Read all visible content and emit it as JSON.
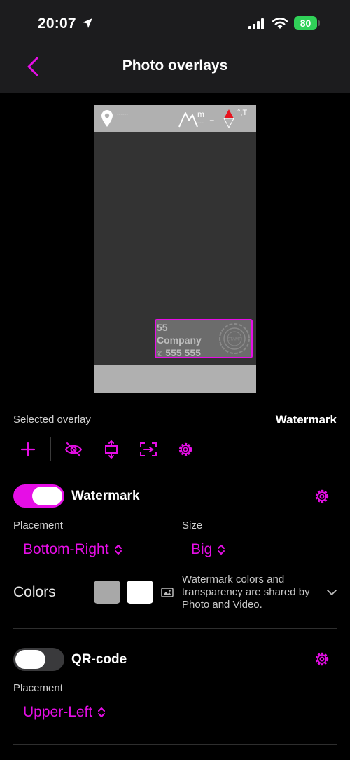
{
  "status_bar": {
    "time": "20:07",
    "battery": "80",
    "icons": [
      "location-arrow-icon",
      "cellular-signal-icon",
      "wifi-icon",
      "battery-icon"
    ]
  },
  "nav": {
    "back_icon": "chevron-left-icon",
    "title": "Photo overlays"
  },
  "preview": {
    "top_bar": {
      "location_value": "------",
      "altitude_unit": "m",
      "altitude_value": "---",
      "separator": "_",
      "temperature": "°,T"
    },
    "watermark": {
      "line1": "55",
      "line2": "Company",
      "line3": "555 555",
      "seal_text": "STAMP"
    }
  },
  "selected_overlay": {
    "label": "Selected overlay",
    "value": "Watermark"
  },
  "toolbar": {
    "icons": [
      "plus-icon",
      "eye-slash-icon",
      "resize-vertical-icon",
      "fit-frame-icon",
      "gear-icon"
    ]
  },
  "watermark_section": {
    "title": "Watermark",
    "enabled": true,
    "placement_label": "Placement",
    "placement_value": "Bottom-Right",
    "size_label": "Size",
    "size_value": "Big",
    "colors_label": "Colors",
    "swatches": [
      "#a8a8a8",
      "#ffffff"
    ],
    "colors_note": "Watermark colors and transparency are shared by Photo and Video."
  },
  "qr_section": {
    "title": "QR-code",
    "enabled": false,
    "placement_label": "Placement",
    "placement_value": "Upper-Left"
  },
  "colors": {
    "accent": "#e60ee6",
    "background": "#000000",
    "header": "#1c1c1e",
    "battery": "#30d158"
  }
}
